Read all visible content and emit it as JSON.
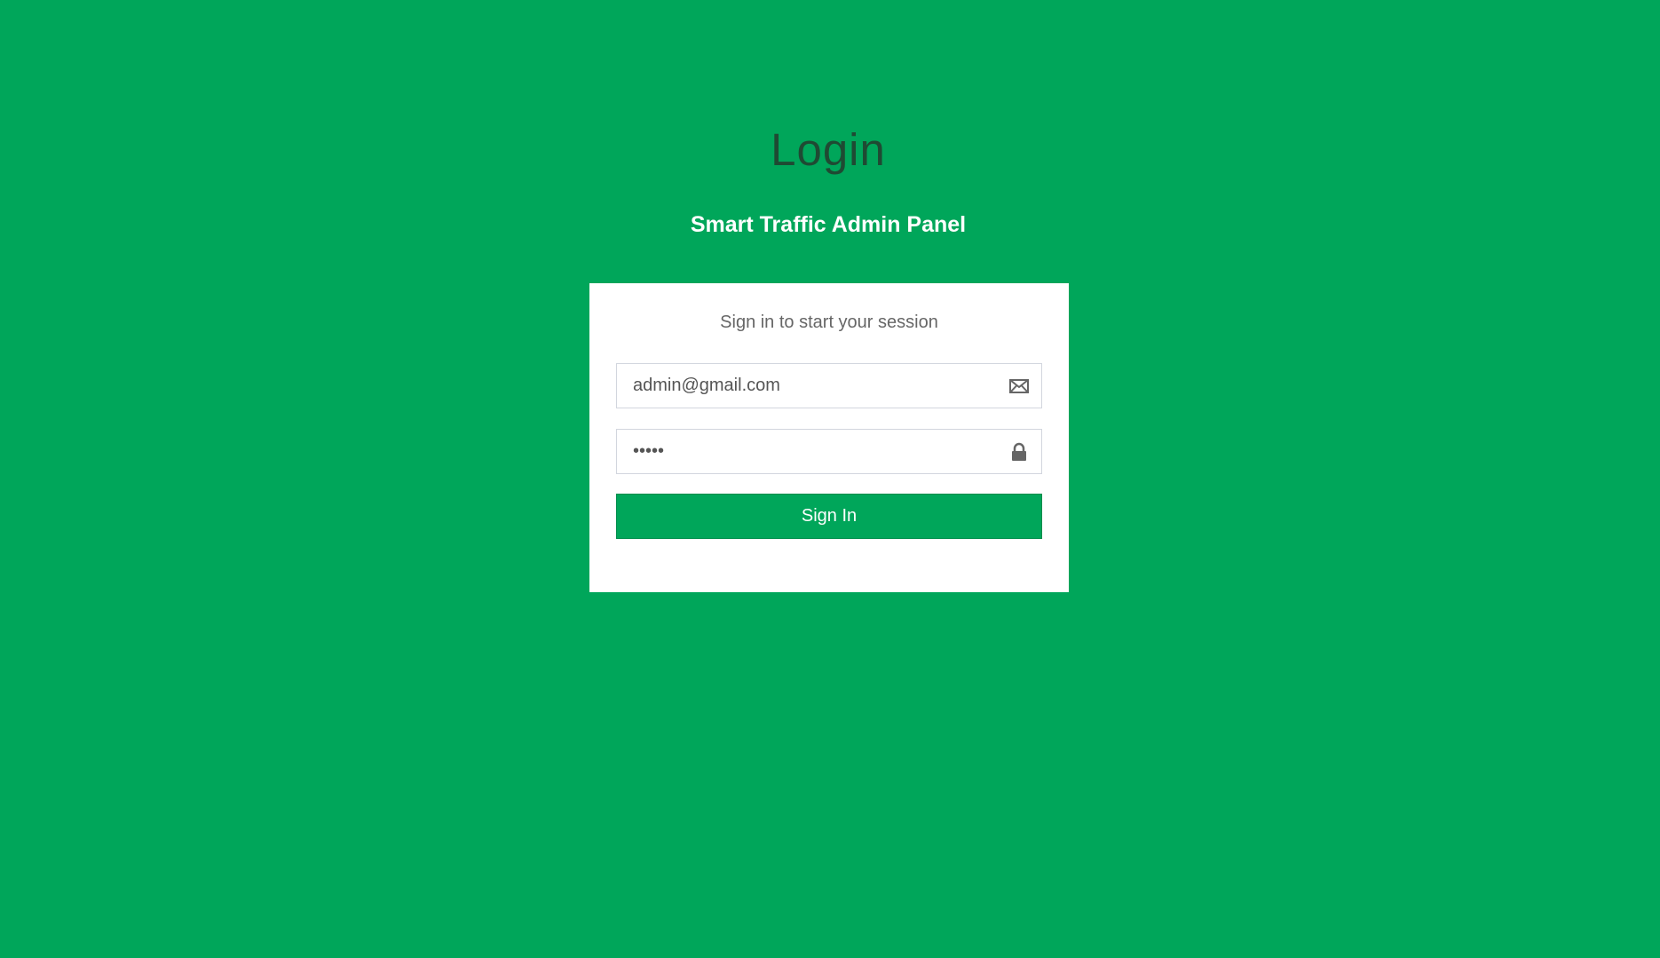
{
  "header": {
    "title": "Login",
    "subtitle": "Smart Traffic Admin Panel"
  },
  "login_box": {
    "message": "Sign in to start your session",
    "email": {
      "value": "admin@gmail.com",
      "icon": "envelope-icon"
    },
    "password": {
      "value": "•••••",
      "icon": "lock-icon"
    },
    "submit_label": "Sign In"
  },
  "colors": {
    "background": "#00a65a",
    "button": "#00a65a",
    "title": "#1f4a33"
  }
}
